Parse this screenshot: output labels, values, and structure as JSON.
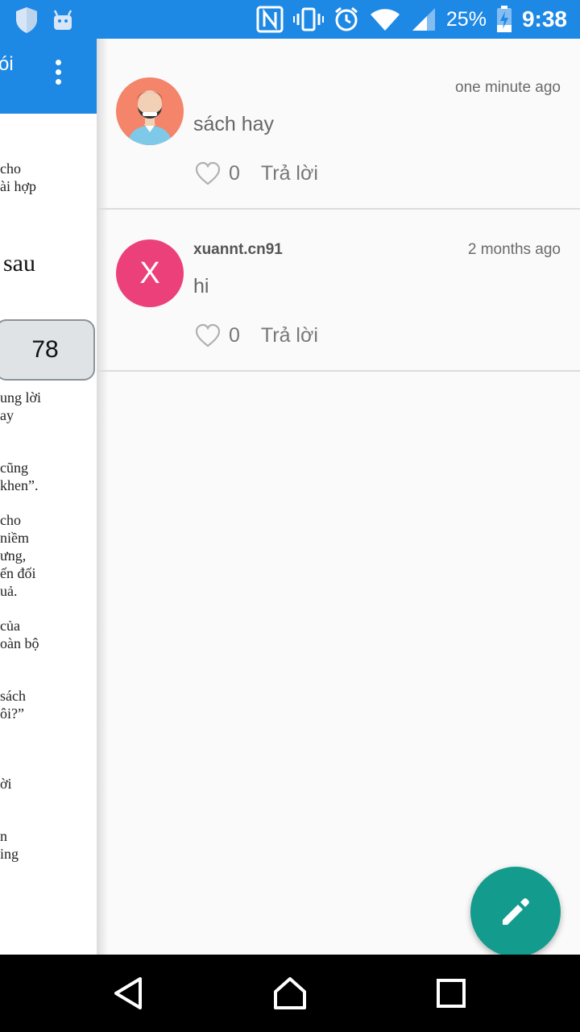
{
  "status_bar": {
    "battery": "25%",
    "time": "9:38",
    "icons": [
      "shield-icon",
      "android-icon",
      "nfc-icon",
      "vibrate-icon",
      "alarm-icon",
      "wifi-icon",
      "signal-icon",
      "battery-charging-icon"
    ]
  },
  "reader": {
    "toolbar_title": "ói",
    "heading": "sau",
    "page_number": "78",
    "lines": [
      "cho",
      "ài hợp",
      "ung lời",
      "ay",
      "cũng",
      "khen”.",
      "cho",
      "niềm",
      "ưng,",
      "ến đối",
      "uả.",
      "của",
      "oàn bộ",
      "sách",
      "ôi?”",
      "ời",
      "n",
      "ing"
    ]
  },
  "comments": [
    {
      "username": "",
      "time": "one minute ago",
      "text": "sách hay",
      "likes": "0",
      "reply_label": "Trả lời",
      "avatar": "person-avatar-icon",
      "avatar_color": "#f4846a"
    },
    {
      "username": "xuannt.cn91",
      "time": "2 months ago",
      "text": "hi",
      "likes": "0",
      "reply_label": "Trả lời",
      "avatar_letter": "X",
      "avatar_color": "#ec407a"
    }
  ],
  "fab": {
    "icon": "pencil-icon",
    "color": "#139c8d"
  },
  "nav": {
    "icons": [
      "back-icon",
      "home-icon",
      "recents-icon"
    ]
  },
  "colors": {
    "primary": "#1e88e5",
    "divider": "#dcdcdc"
  }
}
